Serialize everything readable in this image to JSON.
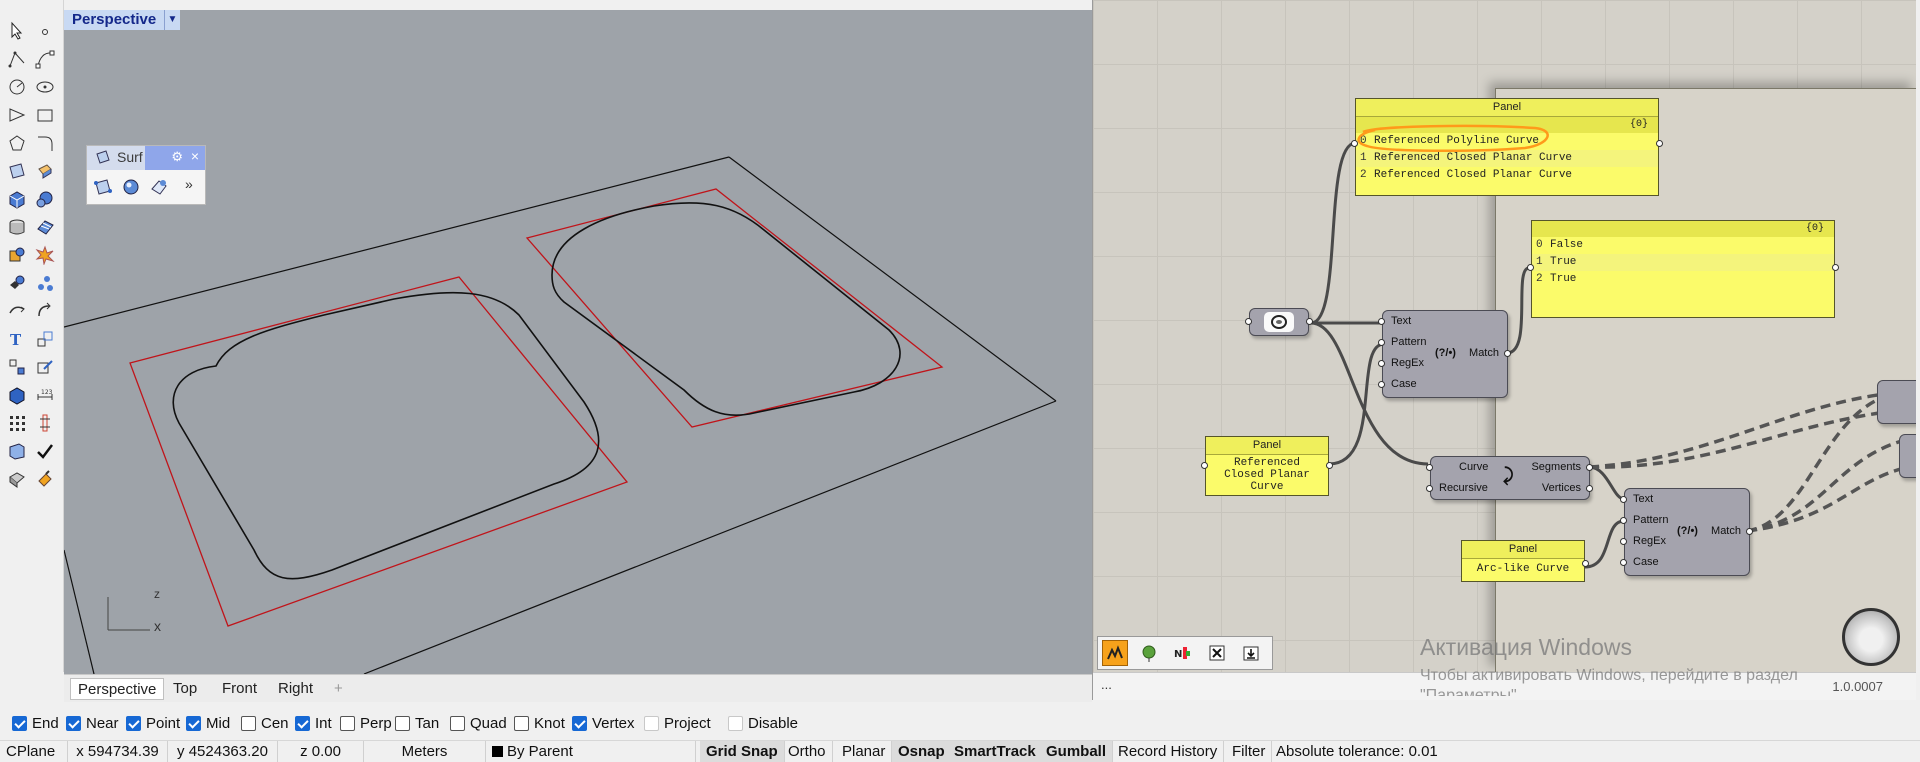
{
  "viewport": {
    "title": "Perspective",
    "axis_x": "x",
    "axis_z": "z",
    "tabs": [
      "Perspective",
      "Top",
      "Front",
      "Right"
    ],
    "add_tab": "+"
  },
  "surface_toolbar": {
    "title": "Surf",
    "gear": "⚙",
    "close": "×",
    "more": "»"
  },
  "osnaps": [
    {
      "label": "End",
      "checked": true
    },
    {
      "label": "Near",
      "checked": true
    },
    {
      "label": "Point",
      "checked": true
    },
    {
      "label": "Mid",
      "checked": true
    },
    {
      "label": "Cen",
      "checked": false
    },
    {
      "label": "Int",
      "checked": true
    },
    {
      "label": "Perp",
      "checked": false
    },
    {
      "label": "Tan",
      "checked": false
    },
    {
      "label": "Quad",
      "checked": false
    },
    {
      "label": "Knot",
      "checked": false
    },
    {
      "label": "Vertex",
      "checked": true
    },
    {
      "label": "Project",
      "checked": false
    },
    {
      "label": "Disable",
      "checked": false
    }
  ],
  "status": {
    "cplane": "CPlane",
    "x": "x 594734.39",
    "y": "y 4524363.20",
    "z": "z 0.00",
    "units": "Meters",
    "layer": "By Parent",
    "grid_snap": "Grid Snap",
    "ortho": "Ortho",
    "planar": "Planar",
    "osnap": "Osnap",
    "smarttrack": "SmartTrack",
    "gumball": "Gumball",
    "record_history": "Record History",
    "filter": "Filter",
    "tolerance": "Absolute tolerance: 0.01"
  },
  "gh": {
    "panel_types": {
      "title": "Panel",
      "path": "{0}",
      "rows": [
        {
          "i": "0",
          "t": "Referenced Polyline Curve"
        },
        {
          "i": "1",
          "t": "Referenced Closed Planar Curve"
        },
        {
          "i": "2",
          "t": "Referenced Closed Planar Curve"
        }
      ]
    },
    "panel_bools": {
      "path": "{0}",
      "rows": [
        {
          "i": "0",
          "t": "False"
        },
        {
          "i": "1",
          "t": "True"
        },
        {
          "i": "2",
          "t": "True"
        }
      ]
    },
    "panel_pattern": {
      "title": "Panel",
      "line1": "Referenced",
      "line2": "Closed Planar",
      "line3": "Curve"
    },
    "panel_arc": {
      "title": "Panel",
      "text": "Arc-like Curve"
    },
    "match1": {
      "inputs": [
        "Text",
        "Pattern",
        "RegEx",
        "Case"
      ],
      "icon": "(?/•)",
      "output": "Match"
    },
    "match2": {
      "inputs": [
        "Text",
        "Pattern",
        "RegEx",
        "Case"
      ],
      "icon": "(?/•)",
      "output": "Match"
    },
    "explode": {
      "inputs": [
        "Curve",
        "Recursive"
      ],
      "outputs": [
        "Segments",
        "Vertices"
      ]
    },
    "bottom_dots": "...",
    "version": "1.0.0007",
    "tools": [
      "sketch",
      "preview",
      "numbers",
      "close",
      "download"
    ]
  },
  "activation": {
    "title": "Активация Windows",
    "sub": "Чтобы активировать Windows, перейдите в раздел",
    "sub2": "\"Параметры\""
  },
  "colors": {
    "viewport_bg": "#9ea3a9",
    "panel_yellow": "#fbfb6a",
    "highlight_orange": "#ff9a1a",
    "curve_red": "#c0141a",
    "checkbox_blue": "#1668d4"
  }
}
